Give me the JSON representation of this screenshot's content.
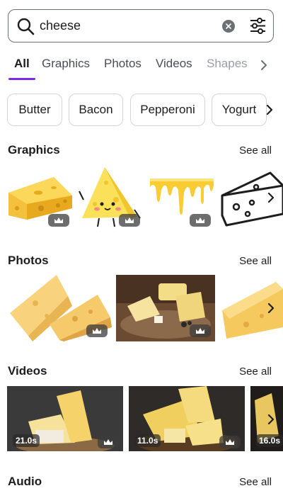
{
  "search": {
    "value": "cheese",
    "placeholder": "Search"
  },
  "tabs": [
    {
      "label": "All"
    },
    {
      "label": "Graphics"
    },
    {
      "label": "Photos"
    },
    {
      "label": "Videos"
    },
    {
      "label": "Shapes"
    }
  ],
  "chips": [
    {
      "label": "Butter"
    },
    {
      "label": "Bacon"
    },
    {
      "label": "Pepperoni"
    },
    {
      "label": "Yogurt"
    }
  ],
  "sections": {
    "graphics": {
      "title": "Graphics",
      "see_all": "See all"
    },
    "photos": {
      "title": "Photos",
      "see_all": "See all"
    },
    "videos": {
      "title": "Videos",
      "see_all": "See all",
      "items": [
        {
          "duration": "21.0s"
        },
        {
          "duration": "11.0s"
        },
        {
          "duration": "16.0s"
        }
      ]
    },
    "audio": {
      "title": "Audio",
      "see_all": "See all"
    }
  },
  "colors": {
    "accent": "#7d2ae8",
    "cheese": "#f6c93e",
    "cheese_dark": "#e0a722",
    "text": "#1d1d1f"
  },
  "icons": [
    "search-icon",
    "clear-icon",
    "filter-icon",
    "chevron-right-icon",
    "crown-icon"
  ]
}
